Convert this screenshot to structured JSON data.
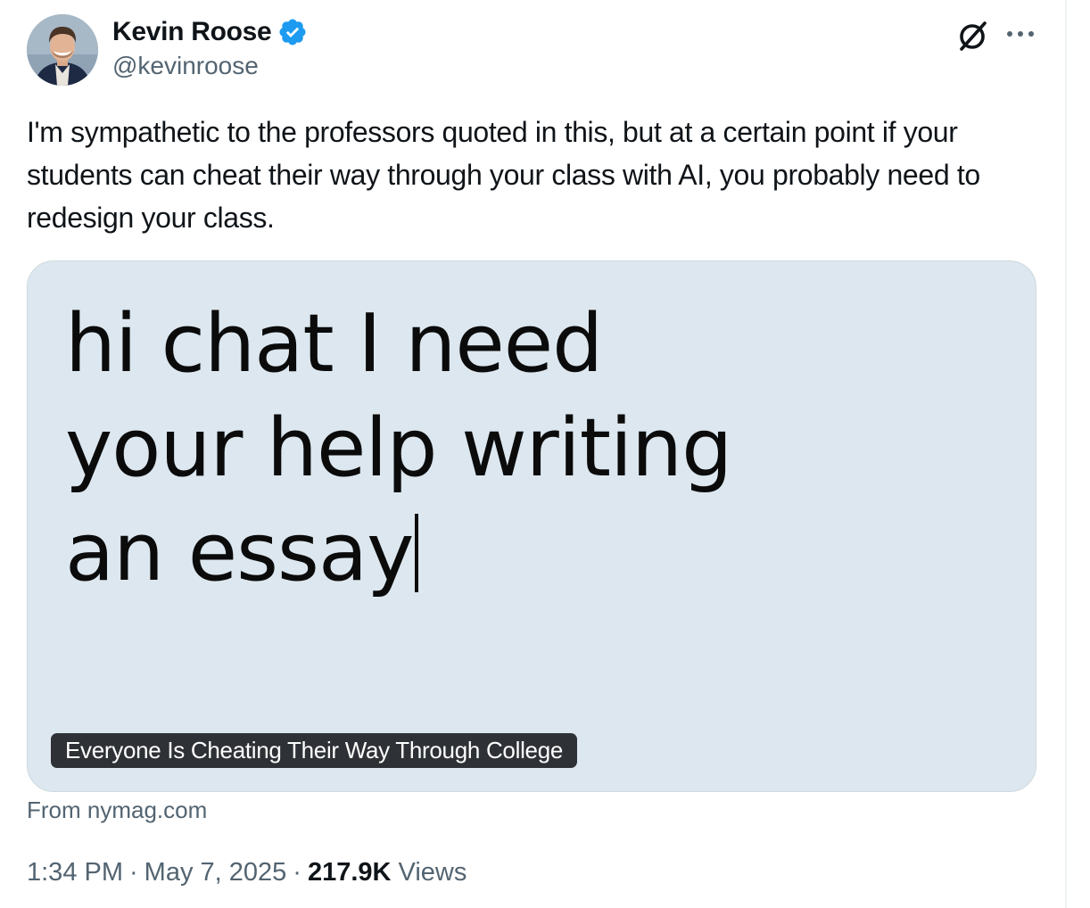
{
  "author": {
    "name": "Kevin Roose",
    "handle": "@kevinroose",
    "verified": true,
    "verified_badge_color": "#1d9bf0"
  },
  "header_actions": {
    "grok_icon": "grok-icon",
    "more_icon": "more-options-icon"
  },
  "tweet": {
    "text": "I'm sympathetic to the professors quoted in this, but at a certain point if your students can cheat their way through your class with AI, you probably need to redesign your class."
  },
  "link_card": {
    "image_text_lines": [
      "hi chat I need",
      "your help writing",
      "an essay"
    ],
    "title": "Everyone Is Cheating Their Way Through College",
    "background_color": "#dce7ef",
    "source": "From nymag.com"
  },
  "meta": {
    "time": "1:34 PM",
    "date": "May 7, 2025",
    "separator": "·",
    "views_count": "217.9K",
    "views_label": "Views"
  },
  "colors": {
    "text_primary": "#0f1419",
    "text_secondary": "#536471",
    "border": "#cfd9de"
  }
}
